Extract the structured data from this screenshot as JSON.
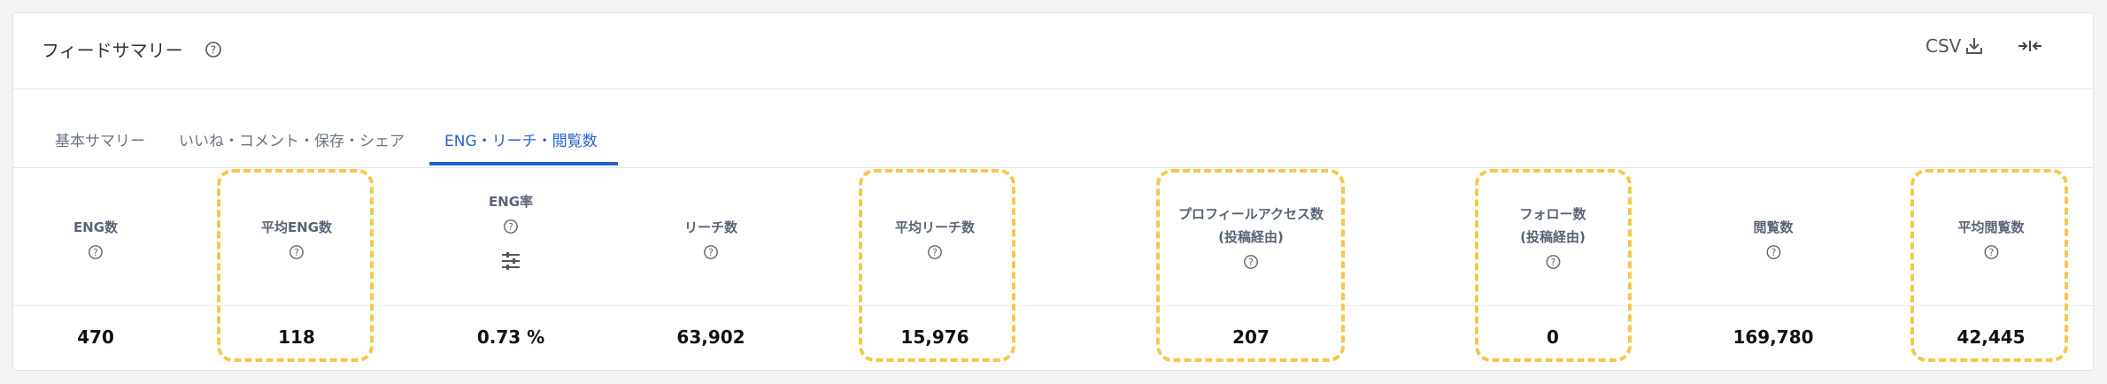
{
  "header": {
    "title": "フィードサマリー",
    "csv_label": "CSV"
  },
  "tabs": [
    {
      "label": "基本サマリー"
    },
    {
      "label": "いいね・コメント・保存・シェア"
    },
    {
      "label": "ENG・リーチ・閲覧数"
    }
  ],
  "active_tab": "ENG・リーチ・閲覧数",
  "columns": [
    {
      "label": "ENG数",
      "value": "470"
    },
    {
      "label": "平均ENG数",
      "value": "118"
    },
    {
      "label": "ENG率",
      "value": "0.73 %"
    },
    {
      "label": "リーチ数",
      "value": "63,902"
    },
    {
      "label": "平均リーチ数",
      "value": "15,976"
    },
    {
      "label": "プロフィールアクセス数",
      "label2": "(投稿経由)",
      "value": "207"
    },
    {
      "label": "フォロー数",
      "label2": "(投稿経由)",
      "value": "0"
    },
    {
      "label": "閲覧数",
      "value": "169,780"
    },
    {
      "label": "平均閲覧数",
      "value": "42,445"
    }
  ],
  "colors": {
    "accent": "#2563c9",
    "highlight": "#f5c84c"
  },
  "icons": [
    "help-circle-icon",
    "download-icon",
    "collapse-icon",
    "sliders-icon"
  ]
}
